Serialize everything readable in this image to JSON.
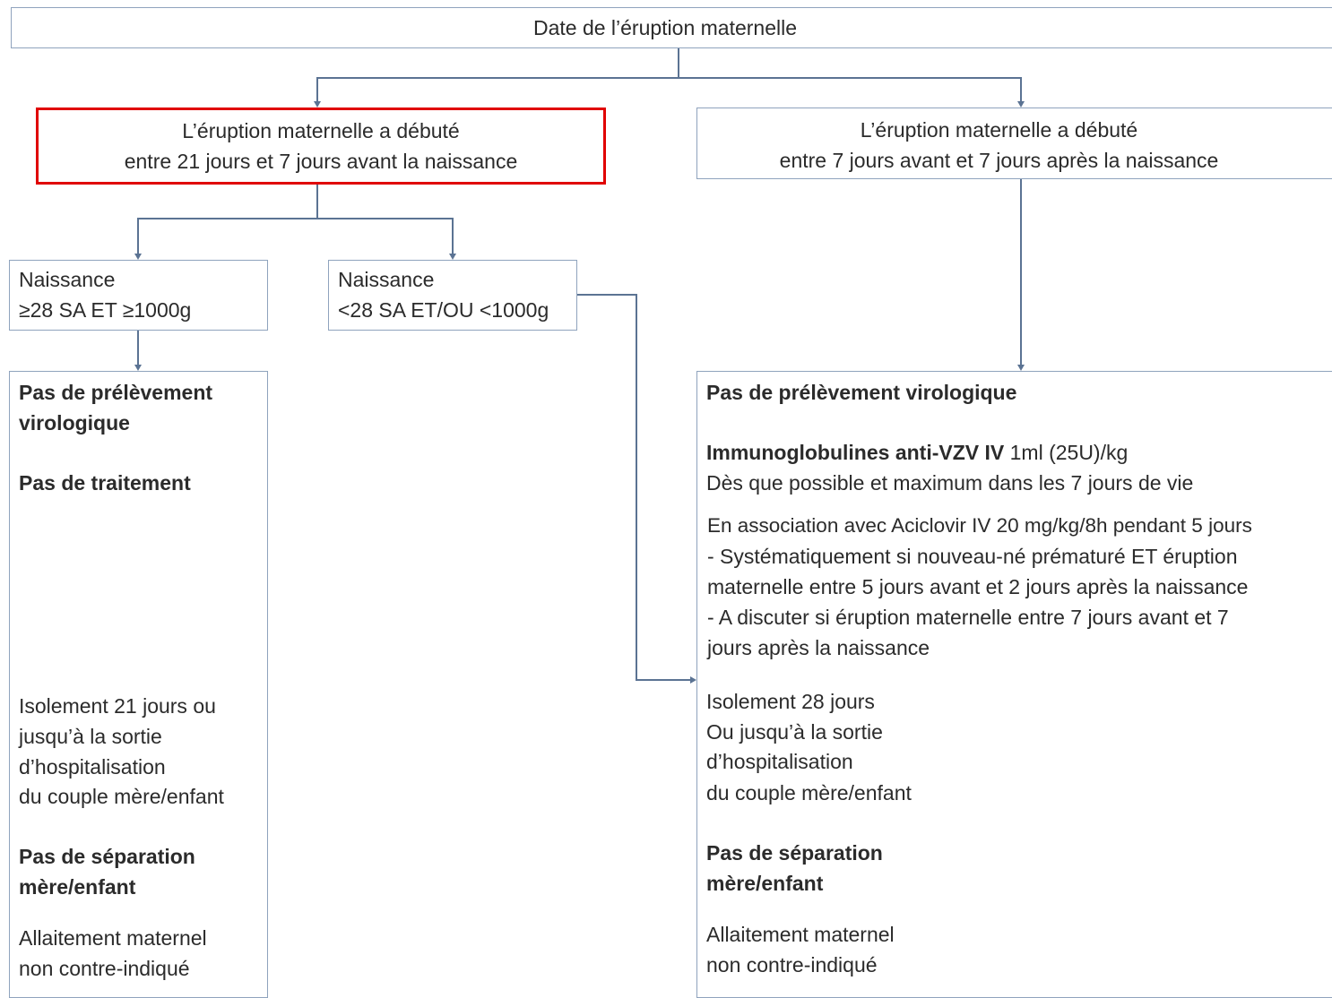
{
  "root": {
    "label": "Date de l’éruption maternelle"
  },
  "branch_left": {
    "line1": "L’éruption maternelle a débuté",
    "line2": "entre 21 jours et 7 jours avant la naissance",
    "highlight_color": "#e00000"
  },
  "branch_right": {
    "line1": "L’éruption maternelle a débuté",
    "line2": "entre 7 jours avant et 7 jours après la naissance"
  },
  "birth_ge28": {
    "line1": "Naissance",
    "line2": "≥28 SA ET ≥1000g"
  },
  "birth_lt28": {
    "line1": "Naissance",
    "line2": "<28 SA ET/OU <1000g"
  },
  "left_outcome": {
    "no_sampling_1": "Pas de prélèvement",
    "no_sampling_2": "virologique",
    "no_treatment": "Pas de traitement",
    "isolation_1": "Isolement 21 jours ou",
    "isolation_2": "jusqu’à la sortie",
    "isolation_3": "d’hospitalisation",
    "isolation_4": "du couple mère/enfant",
    "no_separation_1": "Pas de séparation",
    "no_separation_2": "mère/enfant",
    "breastfeeding_1": "Allaitement maternel",
    "breastfeeding_2": "non contre-indiqué"
  },
  "right_outcome": {
    "no_sampling": "Pas de prélèvement virologique",
    "ig_bold": "Immunoglobulines anti-VZV IV",
    "ig_dose": " 1ml (25U)/kg",
    "ig_timing": "Dès que possible et maximum dans les 7 jours de vie",
    "aciclovir_1": "En association avec Aciclovir IV 20 mg/kg/8h pendant 5 jours",
    "aciclovir_2": "- Systématiquement si nouveau-né prématuré ET éruption",
    "aciclovir_3": "maternelle entre 5 jours avant et 2 jours après la naissance",
    "aciclovir_4": "- A discuter si éruption maternelle entre 7 jours avant et 7",
    "aciclovir_5": "jours après la naissance",
    "isolation_1": "Isolement 28 jours",
    "isolation_2": "Ou jusqu’à la sortie",
    "isolation_3": "d’hospitalisation",
    "isolation_4": "du couple mère/enfant",
    "no_separation_1": "Pas de séparation",
    "no_separation_2": "mère/enfant",
    "breastfeeding_1": "Allaitement maternel",
    "breastfeeding_2": "non contre-indiqué"
  }
}
